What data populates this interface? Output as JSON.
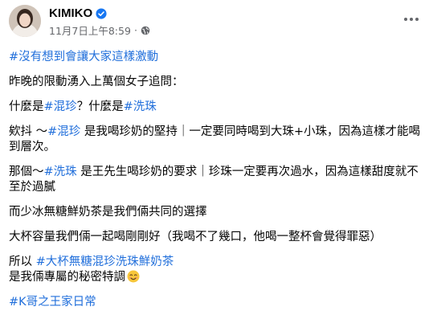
{
  "post": {
    "author": "KIMIKO",
    "timestamp": "11月7日上午8:59",
    "meta_separator": "·",
    "privacy_icon": "globe-icon",
    "more_icon": "more-horizontal-icon",
    "verified_icon": "verified-badge-icon",
    "link_color": "#216fdb",
    "verified_color": "#1877f2"
  },
  "content": {
    "line1_tag": "#沒有想到會讓大家這樣激動",
    "line2": "昨晚的限動湧入上萬個女子追問：",
    "line3": {
      "a": "什麼是",
      "tag1": "#混珍",
      "b": "？什麼是",
      "tag2": "#洗珠"
    },
    "para4": {
      "a": "欸抖 ～",
      "tag": "#混珍",
      "b": "是我喝珍奶的堅持｜一定要同時喝到大珠+小珠，因為這樣才能喝到層次。"
    },
    "para5": {
      "a": "那個～",
      "tag": "#洗珠",
      "b": "是王先生喝珍奶的要求｜珍珠一定要再次過水，因為這樣甜度就不至於過膩"
    },
    "line6": "而少冰無糖鮮奶茶是我們倆共同的選擇",
    "para7": "大杯容量我們倆一起喝剛剛好（我喝不了幾口，他喝一整杯會覺得罪惡）",
    "para8": {
      "a": "所以",
      "tag": "#大杯無糖混珍洗珠鮮奶茶",
      "b": "是我倆專屬的秘密特調",
      "emoji": "smiling-face-emoji"
    },
    "line9_tag": "#K哥之王家日常"
  }
}
